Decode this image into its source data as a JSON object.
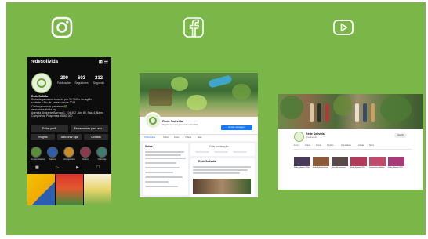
{
  "colors": {
    "background": "#7ab648",
    "icon_stroke": "#ffffff",
    "instagram_bg": "#0d0d0d",
    "facebook_blue": "#1877f2",
    "youtube_bg": "#ffffff"
  },
  "social_icons": [
    {
      "name": "instagram-icon"
    },
    {
      "name": "facebook-icon"
    },
    {
      "name": "youtube-icon"
    }
  ],
  "instagram": {
    "handle": "redesolivida",
    "stats": [
      {
        "value": "290",
        "label": "Publicações"
      },
      {
        "value": "603",
        "label": "Seguidores"
      },
      {
        "value": "212",
        "label": "Seguindo"
      }
    ],
    "bio_name": "Rede Solidão",
    "bio_lines": [
      "Rede de parceiros formada por 34 ONGs da região",
      "sudeste e Rio de Janeiro desde 2013",
      "Conheça nossos parceiros 🌿",
      "www.redesolivida.org",
      "Avenida Almirante Barroso 1, 104 402 - Ant 80, Sala 4, Bairro",
      "Campinhos, Pirapemas 65460-000"
    ],
    "buttons_row1": [
      "Editar perfil",
      "Ferramentas para ano..."
    ],
    "buttons_row2": [
      "Insights",
      "Adicionar loja",
      "Contato"
    ],
    "highlights": [
      "Comunidades",
      "Salvos",
      "Campanha",
      "Sobre",
      "Notícias"
    ]
  },
  "facebook": {
    "page_name": "Rede Solivida",
    "page_sub": "Organização não governamental (ONG)",
    "primary_button": "Enviar mensagem",
    "nav_tabs": [
      "Publicações",
      "Sobre",
      "Fotos",
      "Vídeos",
      "Mais"
    ],
    "about_title": "Sobre",
    "post_author": "Rede Solivida",
    "create_post": "Criar publicação"
  },
  "youtube": {
    "channel_name": "Rede Solivida",
    "channel_sub": "@redesolivida",
    "subscribe": "Inscrito",
    "tabs": [
      "Início",
      "Vídeos",
      "Shorts",
      "Playlists",
      "Comunidade",
      "Canais",
      "Sobre"
    ],
    "videos": [
      "Rede Solivida ONGs",
      "Rede Solivida Nova",
      "Reunião parceiros",
      "Rede Solivida 2023",
      "Campanha solidária",
      "Rede Solivida 2022"
    ]
  }
}
